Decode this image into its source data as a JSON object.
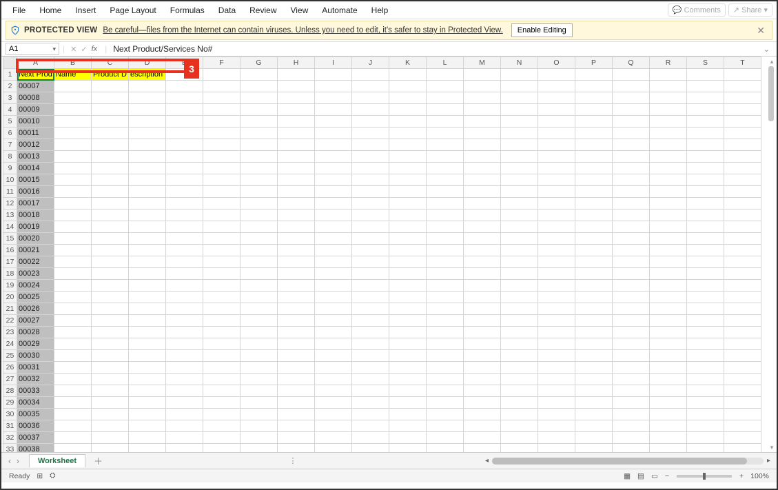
{
  "ribbon": {
    "tabs": [
      "File",
      "Home",
      "Insert",
      "Page Layout",
      "Formulas",
      "Data",
      "Review",
      "View",
      "Automate",
      "Help"
    ],
    "comments": "Comments",
    "share": "Share"
  },
  "protected_view": {
    "label": "PROTECTED VIEW",
    "message": "Be careful—files from the Internet can contain viruses. Unless you need to edit, it's safer to stay in Protected View.",
    "enable_button": "Enable Editing"
  },
  "formula_bar": {
    "name_box": "A1",
    "fx": "fx",
    "value": "Next Product/Services No#"
  },
  "columns": [
    "A",
    "B",
    "C",
    "D",
    "E",
    "F",
    "G",
    "H",
    "I",
    "J",
    "K",
    "L",
    "M",
    "N",
    "O",
    "P",
    "Q",
    "R",
    "S",
    "T"
  ],
  "header_row": {
    "A": "Next Prod",
    "B": "Name",
    "C": "Product D",
    "D": "escription"
  },
  "rows": [
    "00007",
    "00008",
    "00009",
    "00010",
    "00011",
    "00012",
    "00013",
    "00014",
    "00015",
    "00016",
    "00017",
    "00018",
    "00019",
    "00020",
    "00021",
    "00022",
    "00023",
    "00024",
    "00025",
    "00026",
    "00027",
    "00028",
    "00029",
    "00030",
    "00031",
    "00032",
    "00033",
    "00034",
    "00035",
    "00036",
    "00037",
    "00038"
  ],
  "annotation": {
    "number": "3"
  },
  "sheet_tabs": {
    "active": "Worksheet"
  },
  "status": {
    "ready": "Ready",
    "zoom": "100%"
  }
}
